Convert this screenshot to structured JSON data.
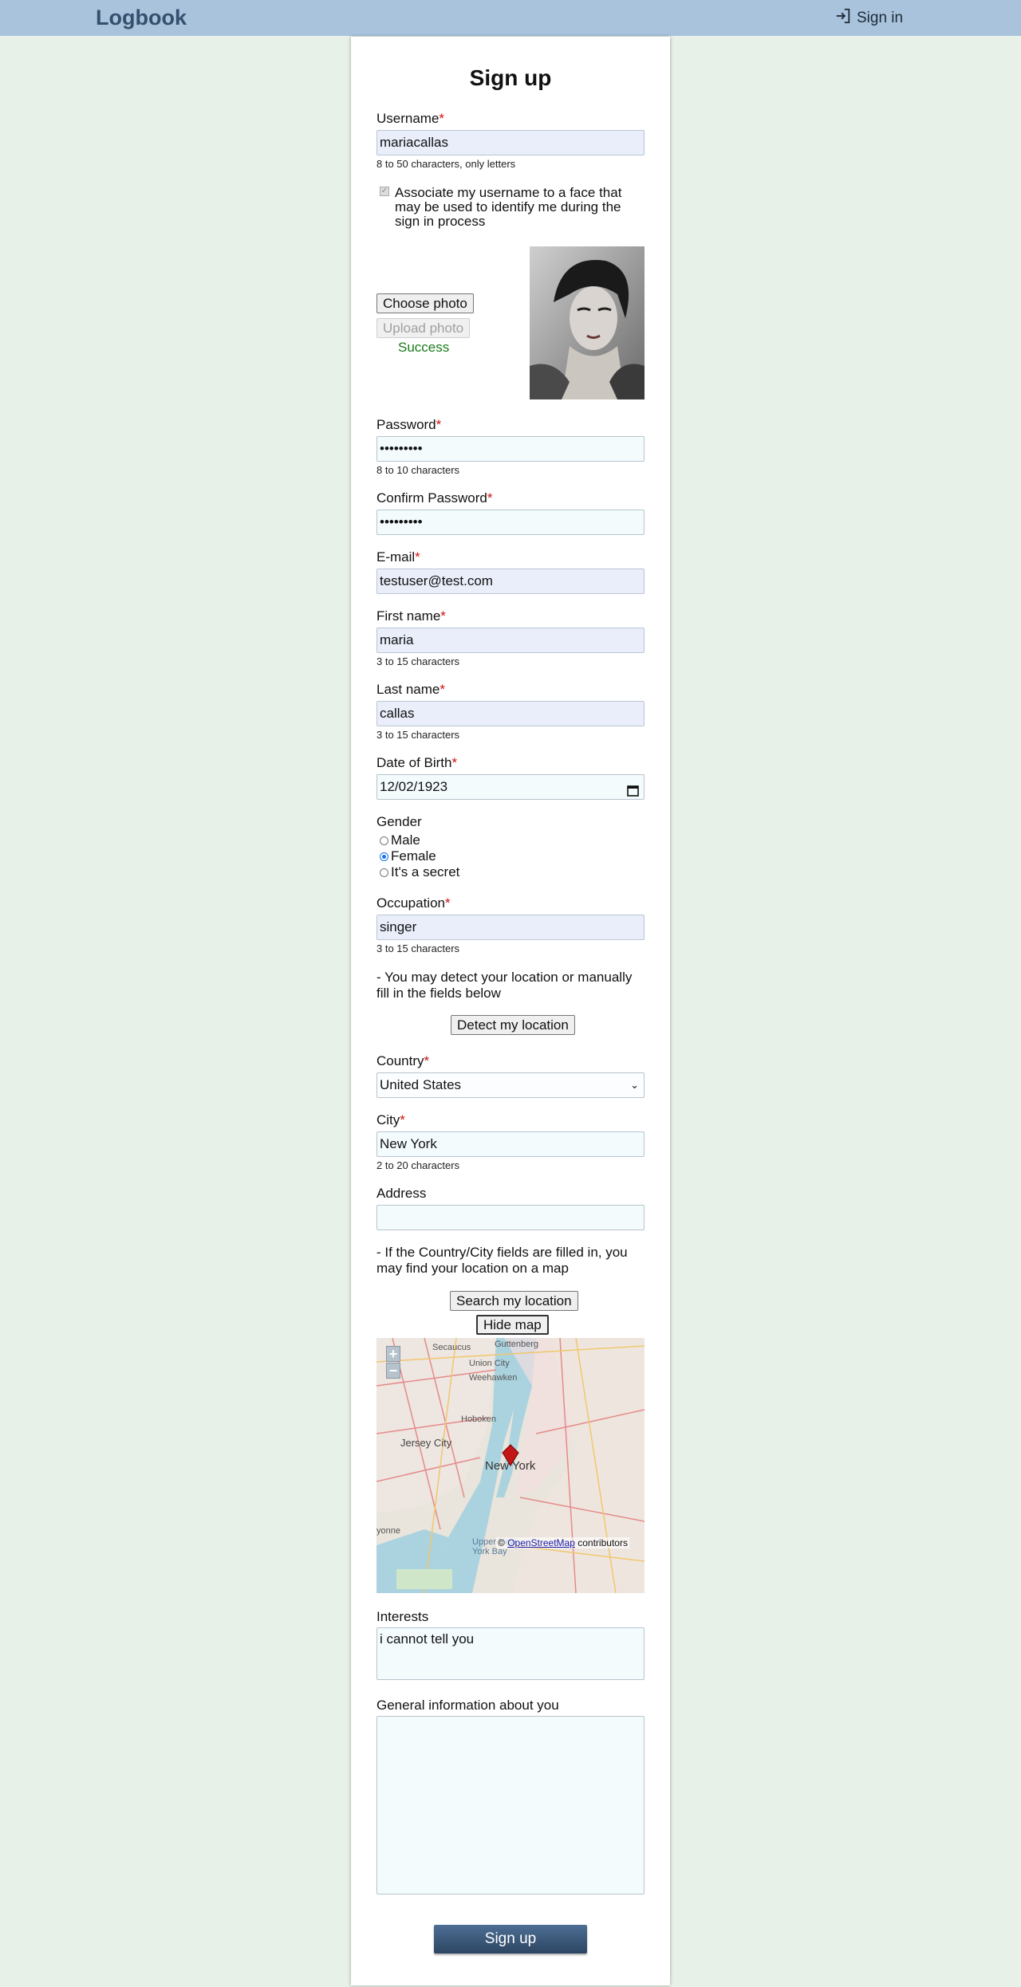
{
  "header": {
    "brand": "Logbook",
    "signin_label": "Sign in"
  },
  "form": {
    "title": "Sign up",
    "username": {
      "label": "Username",
      "value": "mariacallas",
      "hint": "8 to 50 characters, only letters"
    },
    "face_option": {
      "label": "Associate my username to a face that may be used to identify me during the sign in process",
      "checked": true
    },
    "photo": {
      "choose_label": "Choose photo",
      "upload_label": "Upload photo",
      "status": "Success"
    },
    "password": {
      "label": "Password",
      "value": "•••••••••",
      "hint": "8 to 10 characters"
    },
    "confirm_password": {
      "label": "Confirm Password",
      "value": "•••••••••"
    },
    "email": {
      "label": "E-mail",
      "value": "testuser@test.com"
    },
    "first_name": {
      "label": "First name",
      "value": "maria",
      "hint": "3 to 15 characters"
    },
    "last_name": {
      "label": "Last name",
      "value": "callas",
      "hint": "3 to 15 characters"
    },
    "dob": {
      "label": "Date of Birth",
      "value": "12/02/1923"
    },
    "gender": {
      "label": "Gender",
      "options": [
        "Male",
        "Female",
        "It's a secret"
      ],
      "selected": "Female"
    },
    "occupation": {
      "label": "Occupation",
      "value": "singer",
      "hint": "3 to 15 characters"
    },
    "location_info": "- You may detect your location or manually fill in the fields below",
    "detect_label": "Detect my location",
    "country": {
      "label": "Country",
      "value": "United States"
    },
    "city": {
      "label": "City",
      "value": "New York",
      "hint": "2 to 20 characters"
    },
    "address": {
      "label": "Address",
      "value": ""
    },
    "map_info": "- If the Country/City fields are filled in, you may find your location on a map",
    "search_label": "Search my location",
    "hide_map_label": "Hide map",
    "map": {
      "zoom_in": "+",
      "zoom_out": "−",
      "attribution_prefix": "©",
      "attribution_link": "OpenStreetMap",
      "attribution_suffix": "contributors",
      "place_labels": [
        "Guttenberg",
        "Secaucus",
        "Union City",
        "Weehawken",
        "Hoboken",
        "Jersey City",
        "New York",
        "Upper New York Bay",
        "yonne"
      ]
    },
    "interests": {
      "label": "Interests",
      "value": "i cannot tell you"
    },
    "general_info": {
      "label": "General information about you",
      "value": ""
    },
    "required_mark": "*",
    "submit_label": "Sign up"
  }
}
